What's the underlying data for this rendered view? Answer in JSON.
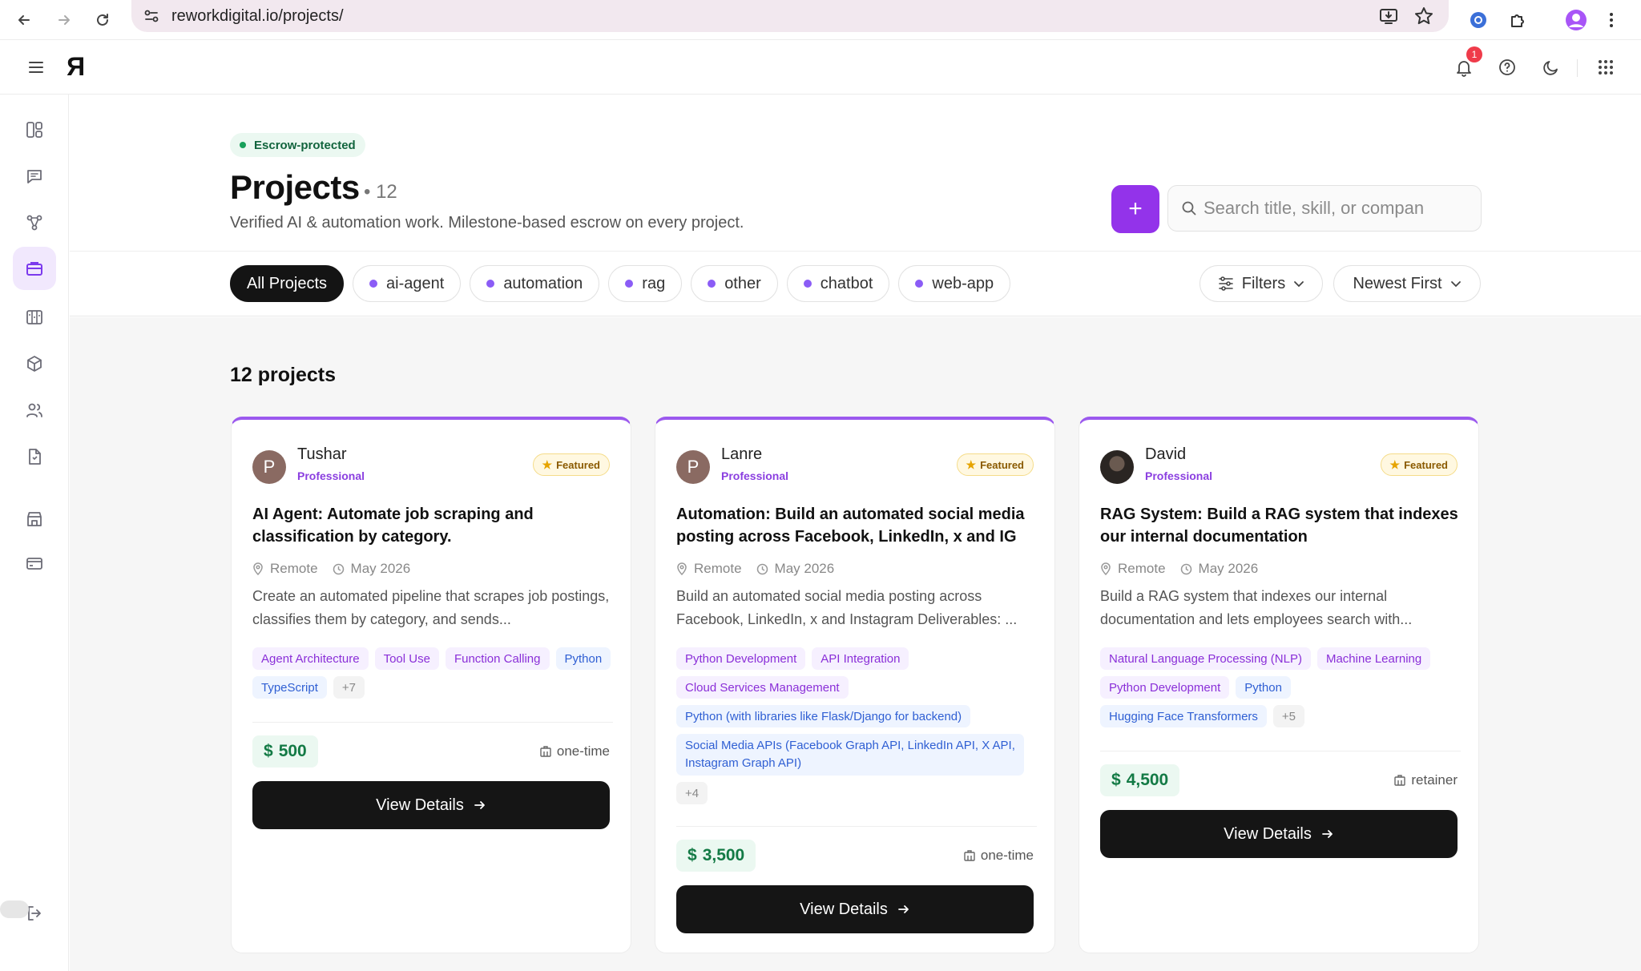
{
  "browser": {
    "url": "reworkdigital.io/projects/",
    "notification_count": "1"
  },
  "header": {
    "escrow_badge": "Escrow-protected",
    "title": "Projects",
    "count": "• 12",
    "subtitle": "Verified AI & automation work. Milestone-based escrow on every project.",
    "add_label": "+",
    "search_placeholder": "Search title, skill, or compan",
    "categories": [
      {
        "label": "All Projects"
      },
      {
        "label": "ai-agent"
      },
      {
        "label": "automation"
      },
      {
        "label": "rag"
      },
      {
        "label": "other"
      },
      {
        "label": "chatbot"
      },
      {
        "label": "web-app"
      }
    ],
    "filters_label": "Filters",
    "sort_label": "Newest First"
  },
  "results_title": "12 projects",
  "cards": [
    {
      "name": "Tushar",
      "initial": "P",
      "rank": "Professional",
      "featured": "Featured",
      "title": "AI Agent: Automate job scraping and classification by category.",
      "location": "Remote",
      "date": "May 2026",
      "description": "Create an automated pipeline that scrapes job postings, classifies them by category, and sends...",
      "tags": [
        {
          "label": "Agent Architecture"
        },
        {
          "label": "Tool Use"
        },
        {
          "label": "Function Calling"
        },
        {
          "label": "Python"
        },
        {
          "label": "TypeScript"
        },
        {
          "label": "+7"
        }
      ],
      "price": "500",
      "price_type": "one-time",
      "button": "View Details"
    },
    {
      "name": "Lanre",
      "initial": "P",
      "rank": "Professional",
      "featured": "Featured",
      "title": "Automation: Build an automated social media posting across Facebook, LinkedIn, x and IG",
      "location": "Remote",
      "date": "May 2026",
      "description": "Build an automated social media posting across Facebook, LinkedIn, x and Instagram Deliverables: ...",
      "tags": [
        {
          "label": "Python Development"
        },
        {
          "label": "API Integration"
        },
        {
          "label": "Cloud Services Management"
        },
        {
          "label": "Python (with libraries like Flask/Django for backend)"
        },
        {
          "label": "Social Media APIs (Facebook Graph API, LinkedIn API, X API, Instagram Graph API)"
        },
        {
          "label": "+4"
        }
      ],
      "price": "3,500",
      "price_type": "one-time",
      "button": "View Details"
    },
    {
      "name": "David",
      "initial": "",
      "rank": "Professional",
      "featured": "Featured",
      "title": "RAG System: Build a RAG system that indexes our internal documentation",
      "location": "Remote",
      "date": "May 2026",
      "description": "Build a RAG system that indexes our internal documentation and lets employees search with...",
      "tags": [
        {
          "label": "Natural Language Processing (NLP)"
        },
        {
          "label": "Machine Learning"
        },
        {
          "label": "Python Development"
        },
        {
          "label": "Python"
        },
        {
          "label": "Hugging Face Transformers"
        },
        {
          "label": "+5"
        }
      ],
      "price": "4,500",
      "price_type": "retainer",
      "button": "View Details"
    }
  ]
}
